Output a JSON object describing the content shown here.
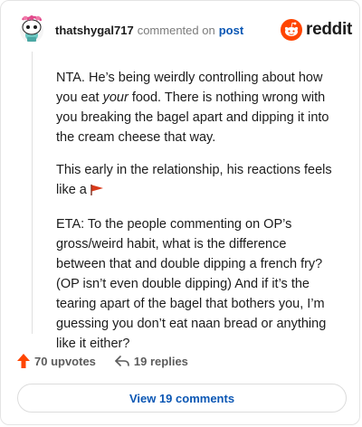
{
  "header": {
    "username": "thatshygal717",
    "commented_on": "commented on",
    "post_link": "post",
    "brand": "reddit"
  },
  "comment": {
    "p1_a": "NTA. He’s being weirdly controlling about how you eat ",
    "p1_em": "your",
    "p1_b": " food. There is nothing wrong with you breaking the bagel apart and dipping it into the cream cheese that way.",
    "p2": "This early in the relationship, his reactions feels like a",
    "p3": "ETA: To the people commenting on OP’s gross/weird habit, what is the difference between that and double dipping a french fry? (OP isn’t even double dipping) And if it’s the tearing apart of the bagel that bothers you, I’m guessing you don’t eat naan bread or anything like it either?"
  },
  "actions": {
    "upvotes": "70 upvotes",
    "replies": "19 replies"
  },
  "view_comments": "View 19 comments",
  "colors": {
    "upvote": "#ff4500",
    "link": "#0b57b4",
    "flag": "#d93a1a"
  },
  "icons": {
    "avatar": "snoo-avatar-icon",
    "brand": "reddit-logo-icon",
    "flag": "red-flag-icon",
    "upvote": "upvote-arrow-icon",
    "reply": "reply-arrow-icon"
  }
}
